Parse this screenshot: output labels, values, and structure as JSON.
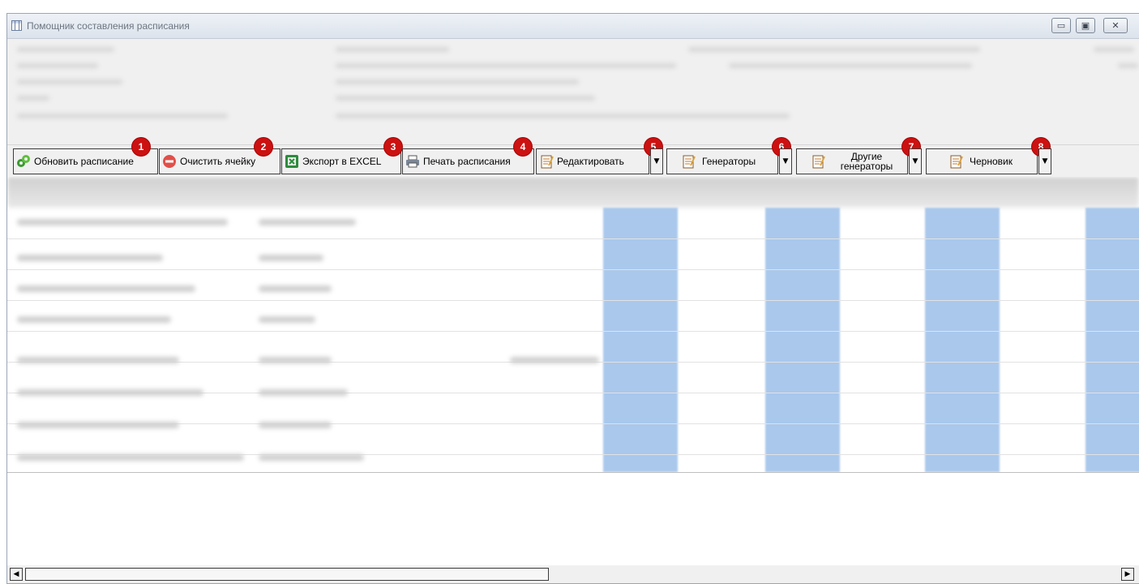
{
  "window": {
    "title": "Помощник составления расписания",
    "controls": {
      "minimize": "▭",
      "restore": "▣",
      "close": "✕"
    }
  },
  "toolbar": {
    "buttons": [
      {
        "label": "Обновить расписание",
        "icon": "refresh-icon",
        "badge": "1"
      },
      {
        "label": "Очистить ячейку",
        "icon": "clear-cell-icon",
        "badge": "2"
      },
      {
        "label": "Экспорт в EXCEL",
        "icon": "excel-icon",
        "badge": "3"
      },
      {
        "label": "Печать расписания",
        "icon": "print-icon",
        "badge": "4"
      },
      {
        "label": "Редактировать",
        "icon": "notepad-icon",
        "badge": "5"
      },
      {
        "label": "Генераторы",
        "icon": "notepad-icon",
        "badge": "6"
      },
      {
        "label_line1": "Другие",
        "label_line2": "генераторы",
        "icon": "notepad-icon",
        "badge": "7"
      },
      {
        "label": "Черновик",
        "icon": "notepad-icon",
        "badge": "8"
      }
    ],
    "dropdown_glyph": "▼"
  },
  "scrollbar": {
    "left_arrow": "◀",
    "right_arrow": "▶"
  },
  "colors": {
    "highlight_column": "#a9c8ec",
    "badge": "#cc1111"
  }
}
